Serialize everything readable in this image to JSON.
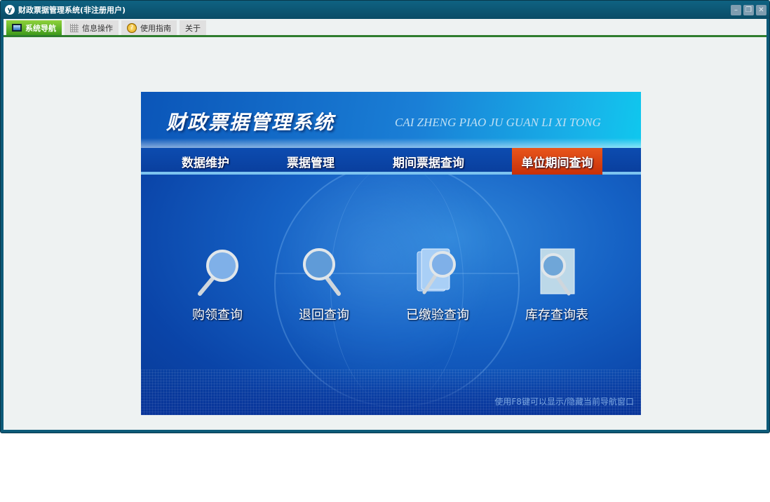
{
  "window": {
    "title": "财政票据管理系统(非注册用户)",
    "logo_text": "y",
    "controls": [
      "minimize",
      "restore",
      "close"
    ]
  },
  "tabs": [
    {
      "label": "系统导航",
      "icon": "monitor-icon",
      "active": true
    },
    {
      "label": "信息操作",
      "icon": "grid-icon"
    },
    {
      "label": "使用指南",
      "icon": "help-icon"
    },
    {
      "label": "关于"
    }
  ],
  "banner": {
    "title": "财政票据管理系统",
    "pinyin": "CAI ZHENG PIAO JU GUAN LI XI TONG",
    "nav": [
      {
        "label": "数据维护"
      },
      {
        "label": "票据管理"
      },
      {
        "label": "期间票据查询"
      },
      {
        "label": "单位期间查询",
        "selected": true
      }
    ],
    "functions": [
      {
        "label": "购领查询",
        "icon": "magnifier-icon"
      },
      {
        "label": "退回查询",
        "icon": "magnifier-icon"
      },
      {
        "label": "已缴验查询",
        "icon": "documents-magnifier-icon"
      },
      {
        "label": "库存查询表",
        "icon": "document-magnifier-icon"
      }
    ],
    "hint": "使用F8键可以显示/隐藏当前导航窗口"
  },
  "colors": {
    "selected_nav": "#d6400f",
    "tab_active": "#5cb52a",
    "banner_blue": "#1561c4"
  }
}
